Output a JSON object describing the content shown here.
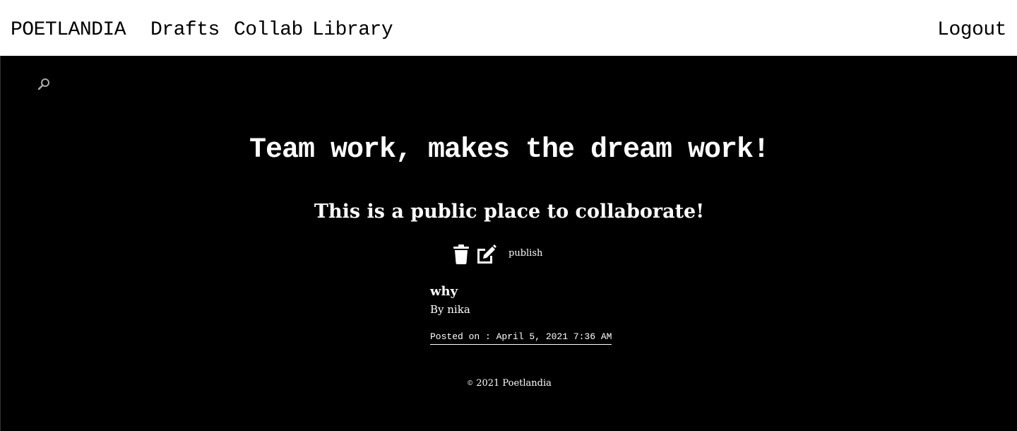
{
  "nav": {
    "brand": "POETLANDIA",
    "links": [
      "Drafts",
      "Collab",
      "Library"
    ],
    "logout": "Logout"
  },
  "search": {
    "icon": "search-icon"
  },
  "hero": {
    "title": "Team work,  makes the dream work!",
    "subtitle": "This is a public place to collaborate!"
  },
  "actions": {
    "delete_icon": "trash-icon",
    "edit_icon": "edit-icon",
    "publish_label": "publish"
  },
  "post": {
    "title": "why",
    "author": "By nika",
    "posted_on": "Posted on : April 5,  2021 7:36 AM"
  },
  "footer": {
    "copyright_symbol": "©",
    "text": "2021 Poetlandia"
  },
  "colors": {
    "navbar_bg": "#ffffff",
    "page_bg": "#000000",
    "text_light": "#ffffff",
    "text_dark": "#000000"
  }
}
